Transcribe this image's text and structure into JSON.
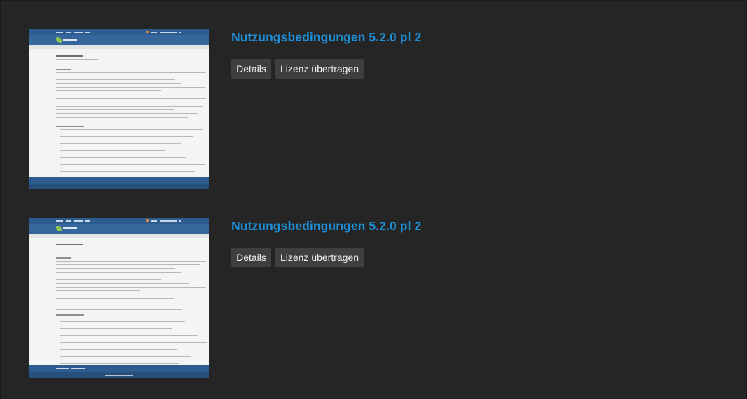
{
  "items": [
    {
      "title": "Nutzungsbedingungen 5.2.0 pl 2",
      "details_label": "Details",
      "license_label": "Lizenz übertragen"
    },
    {
      "title": "Nutzungsbedingungen 5.2.0 pl 2",
      "details_label": "Details",
      "license_label": "Lizenz übertragen"
    }
  ],
  "colors": {
    "page_bg": "#252525",
    "title": "#1e8fd6",
    "button_bg": "#3f3f3f",
    "button_text": "#f0f0f0",
    "thumb_header": "#2c5c90"
  }
}
